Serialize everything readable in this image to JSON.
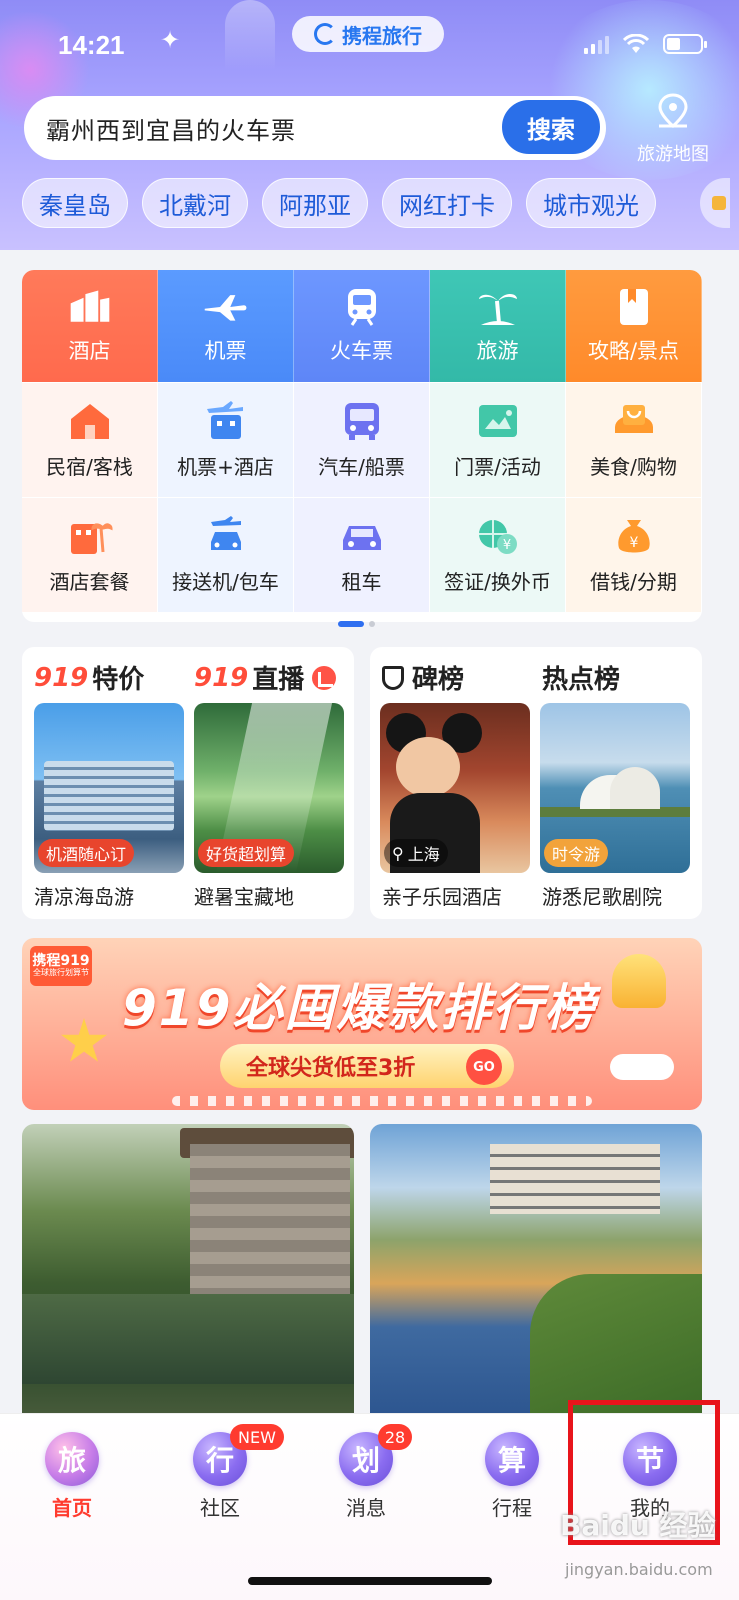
{
  "status_bar": {
    "time": "14:21"
  },
  "brand": {
    "name": "携程旅行"
  },
  "search": {
    "query": "霸州西到宜昌的火车票",
    "button_label": "搜索"
  },
  "map_entry": {
    "label": "旅游地图"
  },
  "chips": [
    "秦皇岛",
    "北戴河",
    "阿那亚",
    "网红打卡",
    "城市观光"
  ],
  "services": {
    "main": [
      {
        "label": "酒店",
        "icon": "hotel-icon"
      },
      {
        "label": "机票",
        "icon": "plane-icon"
      },
      {
        "label": "火车票",
        "icon": "train-icon"
      },
      {
        "label": "旅游",
        "icon": "palm-tree-icon"
      },
      {
        "label": "攻略/景点",
        "icon": "guide-book-icon"
      }
    ],
    "row2": [
      {
        "label": "民宿/客栈",
        "icon": "homestay-icon"
      },
      {
        "label": "机票+酒店",
        "icon": "flight-hotel-icon"
      },
      {
        "label": "汽车/船票",
        "icon": "bus-icon"
      },
      {
        "label": "门票/活动",
        "icon": "ticket-icon"
      },
      {
        "label": "美食/购物",
        "icon": "shopping-bag-icon"
      }
    ],
    "row3": [
      {
        "label": "酒店套餐",
        "icon": "hotel-package-icon"
      },
      {
        "label": "接送机/包车",
        "icon": "airport-transfer-icon"
      },
      {
        "label": "租车",
        "icon": "car-rental-icon"
      },
      {
        "label": "签证/换外币",
        "icon": "visa-currency-icon"
      },
      {
        "label": "借钱/分期",
        "icon": "money-bag-icon"
      }
    ]
  },
  "promo_left": {
    "deal": {
      "prefix": "919",
      "title": "特价",
      "tag": "机酒随心订",
      "caption": "清凉海岛游"
    },
    "live": {
      "prefix": "919",
      "title": "直播",
      "tag": "好货超划算",
      "caption": "避暑宝藏地"
    }
  },
  "promo_right": {
    "rank": {
      "title": "碑榜",
      "tag": "上海",
      "caption": "亲子乐园酒店"
    },
    "hot": {
      "title": "热点榜",
      "tag": "时令游",
      "caption": "游悉尼歌剧院"
    }
  },
  "banner": {
    "badge": "携程919",
    "badge_sub": "全球旅行划算节",
    "headline": "919必囤爆款排行榜",
    "subline": "全球尖货低至3折",
    "go_label": "GO"
  },
  "tabs": [
    {
      "orb": "旅",
      "label": "首页",
      "active": true
    },
    {
      "orb": "行",
      "label": "社区",
      "badge": "NEW"
    },
    {
      "orb": "划",
      "label": "消息",
      "badge": "28"
    },
    {
      "orb": "算",
      "label": "行程"
    },
    {
      "orb": "节",
      "label": "我的"
    }
  ],
  "watermark": {
    "text": "Baidu 经验",
    "url": "jingyan.baidu.com"
  },
  "colors": {
    "accent": "#2a6fe9",
    "active_tab": "#ff3b2f",
    "highlight": "#e8141b"
  }
}
